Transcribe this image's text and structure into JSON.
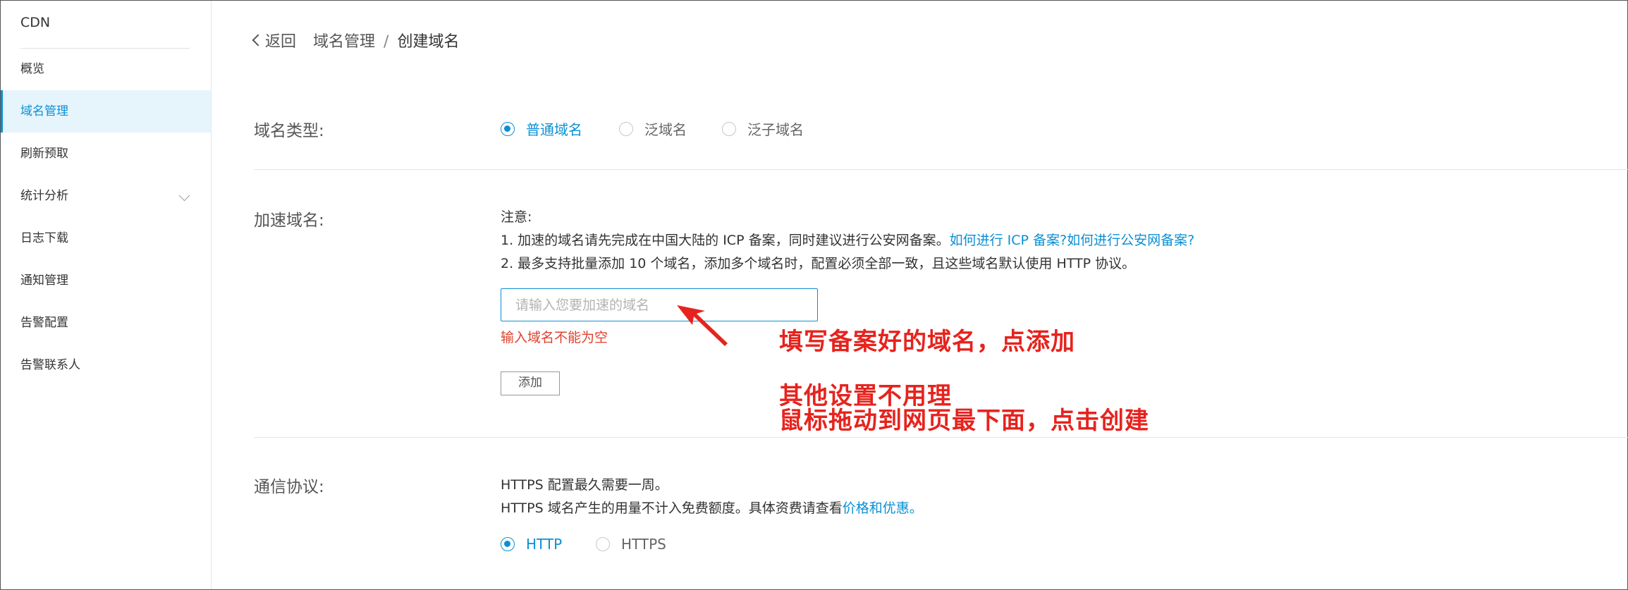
{
  "sidebar": {
    "title": "CDN",
    "items": [
      {
        "label": "概览"
      },
      {
        "label": "域名管理"
      },
      {
        "label": "刷新预取"
      },
      {
        "label": "统计分析"
      },
      {
        "label": "日志下载"
      },
      {
        "label": "通知管理"
      },
      {
        "label": "告警配置"
      },
      {
        "label": "告警联系人"
      }
    ],
    "active_index": 1
  },
  "breadcrumb": {
    "back": "返回",
    "parent": "域名管理",
    "separator": "/",
    "current": "创建域名"
  },
  "domain_type": {
    "label": "域名类型:",
    "options": [
      "普通域名",
      "泛域名",
      "泛子域名"
    ],
    "selected": "普通域名"
  },
  "accel_domain": {
    "label": "加速域名:",
    "note_title": "注意:",
    "note1": "1. 加速的域名请先完成在中国大陆的 ICP 备案，同时建议进行公安网备案。",
    "note1_link_icp": "如何进行 ICP 备案?",
    "note1_link_police": "如何进行公安网备案?",
    "note2": "2. 最多支持批量添加 10 个域名，添加多个域名时，配置必须全部一致，且这些域名默认使用 HTTP 协议。",
    "input_value": "",
    "input_placeholder": "请输入您要加速的域名",
    "error": "输入域名不能为空",
    "add_label": "添加"
  },
  "protocol": {
    "label": "通信协议:",
    "note1": "HTTPS 配置最久需要一周。",
    "note2": "HTTPS 域名产生的用量不计入免费额度。具体资费请查看",
    "note2_link": "价格和优惠",
    "note2_end": "。",
    "options": [
      "HTTP",
      "HTTPS"
    ],
    "selected": "HTTP"
  },
  "annotations": {
    "line1": "填写备案好的域名，点添加",
    "line2": "其他设置不用理",
    "line3": "鼠标拖动到网页最下面，点击创建"
  },
  "colors": {
    "accent": "#0b8fd4",
    "error": "#e0402d",
    "annotation": "#e6231e"
  }
}
